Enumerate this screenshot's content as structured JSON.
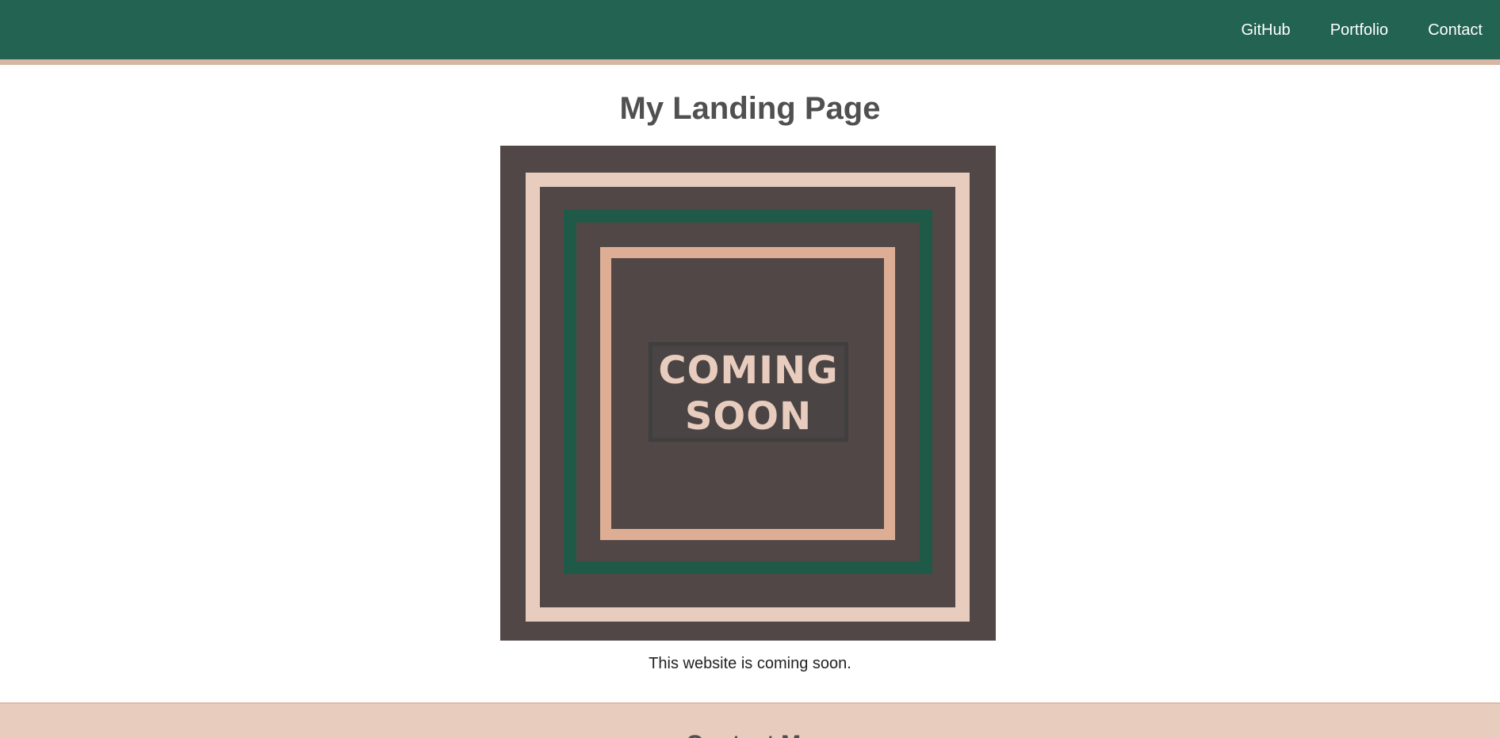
{
  "nav": {
    "links": [
      "GitHub",
      "Portfolio",
      "Contact"
    ]
  },
  "main": {
    "title": "My Landing Page",
    "image": {
      "line1": "COMING",
      "line2": "SOON"
    },
    "caption": "This website is coming soon."
  },
  "contact": {
    "heading": "Contact Me"
  },
  "colors": {
    "header_bg": "#236351",
    "header_border": "#d7b7a3",
    "art_bg": "#514747",
    "art_light": "#e8ccbe",
    "art_green": "#1e5a47",
    "art_peach": "#ddae94",
    "contact_bg": "#e8ccbe"
  }
}
